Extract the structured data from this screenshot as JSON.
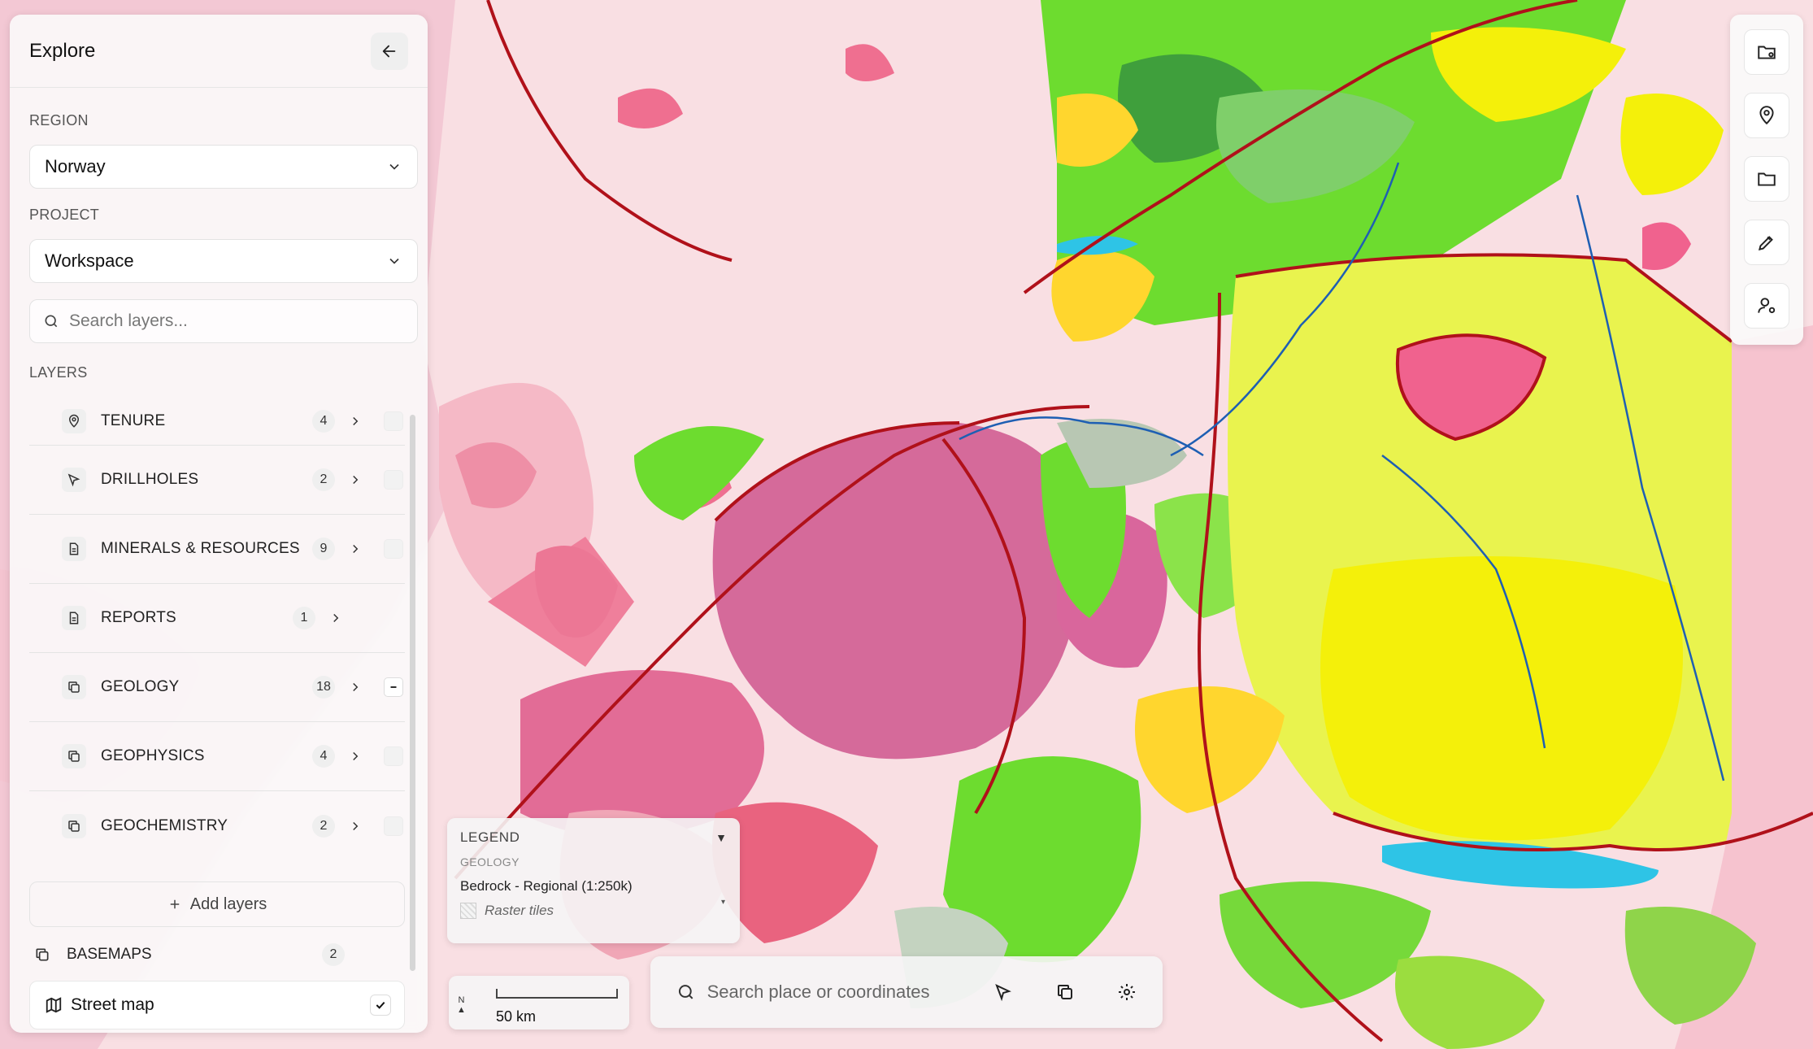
{
  "colors": {
    "map_base": "#f9dfe3",
    "geology_yellow": "#f4f00a",
    "geology_green": "#6ddc2f",
    "geology_magenta": "#d56a9a",
    "fault_red": "#b0111a",
    "fault_blue": "#1e5fb3",
    "panel_bg": "#fafafa"
  },
  "sidebar": {
    "title": "Explore",
    "back_icon": "arrow-left-icon",
    "region": {
      "label": "REGION",
      "value": "Norway"
    },
    "project": {
      "label": "PROJECT",
      "value": "Workspace"
    },
    "search": {
      "placeholder": "Search layers..."
    },
    "layers_label": "LAYERS",
    "layers": [
      {
        "name": "TENURE",
        "count": "4",
        "icon": "map-pin-icon",
        "state": "unchecked"
      },
      {
        "name": "DRILLHOLES",
        "count": "2",
        "icon": "cursor-icon",
        "state": "unchecked"
      },
      {
        "name": "MINERALS & RESOURCES",
        "count": "9",
        "icon": "document-icon",
        "state": "unchecked"
      },
      {
        "name": "REPORTS",
        "count": "1",
        "icon": "document-icon",
        "state": "none"
      },
      {
        "name": "GEOLOGY",
        "count": "18",
        "icon": "layers-icon",
        "state": "partial"
      },
      {
        "name": "GEOPHYSICS",
        "count": "4",
        "icon": "layers-icon",
        "state": "unchecked"
      },
      {
        "name": "GEOCHEMISTRY",
        "count": "2",
        "icon": "layers-icon",
        "state": "unchecked"
      }
    ],
    "add_layers": "Add layers",
    "basemaps": {
      "label": "BASEMAPS",
      "count": "2"
    },
    "street_map": {
      "label": "Street map",
      "checked": true
    }
  },
  "legend": {
    "title": "LEGEND",
    "group": "GEOLOGY",
    "layer": "Bedrock - Regional (1:250k)",
    "item": "Raster tiles"
  },
  "scale": {
    "north": "N",
    "label": "50 km"
  },
  "map_search": {
    "placeholder": "Search place or coordinates"
  },
  "right_toolbar": [
    "folder-settings-icon",
    "map-pin-icon",
    "folder-icon",
    "pen-tool-icon",
    "user-settings-icon"
  ]
}
